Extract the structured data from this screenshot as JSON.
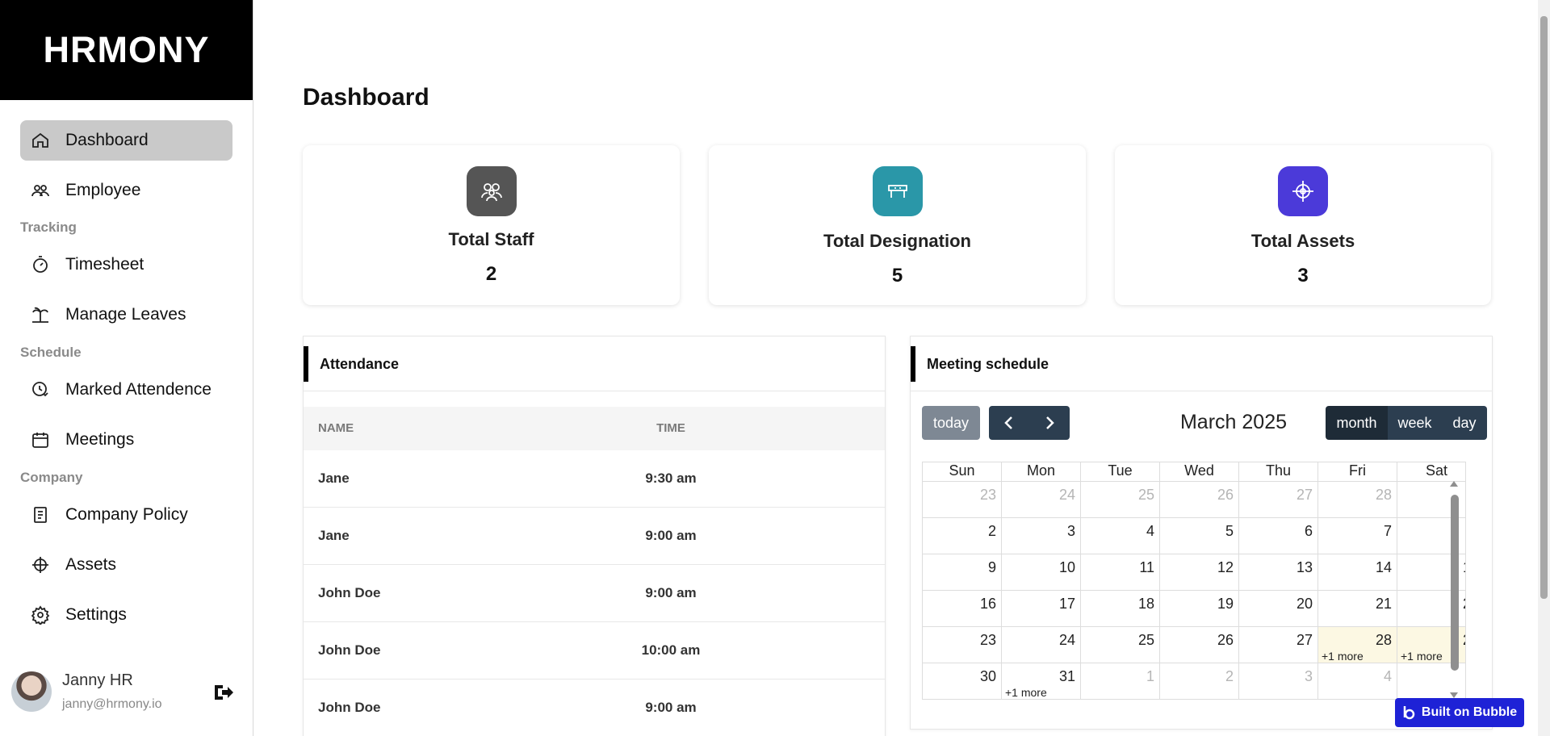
{
  "brand": "HRMONY",
  "sidebar": {
    "items": [
      {
        "label": "Dashboard",
        "icon": "home-icon",
        "active": true
      },
      {
        "label": "Employee",
        "icon": "users-icon"
      },
      {
        "label": "Timesheet",
        "icon": "stopwatch-icon"
      },
      {
        "label": "Manage Leaves",
        "icon": "palm-tree-icon"
      },
      {
        "label": "Marked Attendence",
        "icon": "attendance-clock-icon"
      },
      {
        "label": "Meetings",
        "icon": "calendar-icon"
      },
      {
        "label": "Company Policy",
        "icon": "document-icon"
      },
      {
        "label": "Assets",
        "icon": "compass-icon"
      },
      {
        "label": "Settings",
        "icon": "gear-icon"
      }
    ],
    "sections": [
      "Tracking",
      "Schedule",
      "Company"
    ],
    "user": {
      "name": "Janny HR",
      "email": "janny@hrmony.io"
    }
  },
  "main": {
    "title": "Dashboard",
    "stats": [
      {
        "label": "Total Staff",
        "value": "2",
        "color": "#555555",
        "icon": "group-icon"
      },
      {
        "label": "Total Designation",
        "value": "5",
        "color": "#2a97a8",
        "icon": "desk-icon"
      },
      {
        "label": "Total Assets",
        "value": "3",
        "color": "#4b3ad9",
        "icon": "target-icon"
      }
    ],
    "attendance": {
      "title": "Attendance",
      "columns": [
        "NAME",
        "TIME"
      ],
      "rows": [
        {
          "name": "Jane",
          "time": "9:30 am"
        },
        {
          "name": "Jane",
          "time": "9:00 am"
        },
        {
          "name": "John Doe",
          "time": "9:00 am"
        },
        {
          "name": "John Doe",
          "time": "10:00 am"
        },
        {
          "name": "John Doe",
          "time": "9:00 am"
        }
      ]
    },
    "meetings": {
      "title": "Meeting schedule",
      "today_label": "today",
      "month_title": "March 2025",
      "views": [
        "month",
        "week",
        "day"
      ],
      "weekdays": [
        "Sun",
        "Mon",
        "Tue",
        "Wed",
        "Thu",
        "Fri",
        "Sat"
      ],
      "weeks": [
        [
          {
            "n": "23",
            "o": true
          },
          {
            "n": "24",
            "o": true
          },
          {
            "n": "25",
            "o": true
          },
          {
            "n": "26",
            "o": true
          },
          {
            "n": "27",
            "o": true
          },
          {
            "n": "28",
            "o": true
          },
          {
            "n": "",
            "o": true
          }
        ],
        [
          {
            "n": "2"
          },
          {
            "n": "3"
          },
          {
            "n": "4"
          },
          {
            "n": "5"
          },
          {
            "n": "6"
          },
          {
            "n": "7"
          },
          {
            "n": ""
          }
        ],
        [
          {
            "n": "9"
          },
          {
            "n": "10"
          },
          {
            "n": "11"
          },
          {
            "n": "12"
          },
          {
            "n": "13"
          },
          {
            "n": "14"
          },
          {
            "n": "1"
          }
        ],
        [
          {
            "n": "16"
          },
          {
            "n": "17"
          },
          {
            "n": "18"
          },
          {
            "n": "19"
          },
          {
            "n": "20"
          },
          {
            "n": "21"
          },
          {
            "n": "2"
          }
        ],
        [
          {
            "n": "23"
          },
          {
            "n": "24"
          },
          {
            "n": "25"
          },
          {
            "n": "26"
          },
          {
            "n": "27"
          },
          {
            "n": "28",
            "t": true,
            "m": "+1 more"
          },
          {
            "n": "2",
            "t": true,
            "m": "+1 more"
          }
        ],
        [
          {
            "n": "30"
          },
          {
            "n": "31",
            "m": "+1 more"
          },
          {
            "n": "1",
            "o": true
          },
          {
            "n": "2",
            "o": true
          },
          {
            "n": "3",
            "o": true
          },
          {
            "n": "4",
            "o": true
          },
          {
            "n": "",
            "o": true
          }
        ]
      ]
    }
  },
  "badge": "Built on Bubble"
}
